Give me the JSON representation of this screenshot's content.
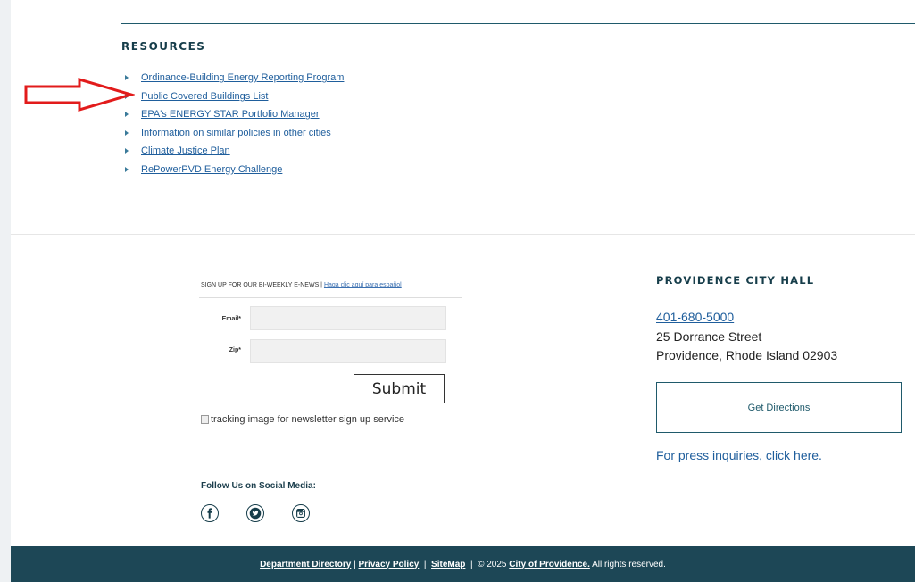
{
  "resources": {
    "title": "RESOURCES",
    "links": [
      "Ordinance-Building Energy Reporting Program",
      "Public Covered Buildings List",
      "EPA's ENERGY STAR Portfolio Manager",
      "Information on similar policies in other cities",
      "Climate Justice Plan",
      "RePowerPVD Energy Challenge"
    ]
  },
  "newsletter": {
    "heading": "SIGN UP FOR OUR BI-WEEKLY E-NEWS | ",
    "spanish_link": "Haga clic aquí para español",
    "email_label": "Email*",
    "zip_label": "Zip*",
    "submit_label": "Submit",
    "tracking_alt": "tracking image for newsletter sign up service"
  },
  "social": {
    "heading": "Follow Us on Social Media:",
    "icons": [
      "facebook-icon",
      "twitter-icon",
      "instagram-icon"
    ]
  },
  "city_hall": {
    "title": "PROVIDENCE CITY HALL",
    "phone": "401-680-5000",
    "street": "25 Dorrance Street",
    "city": "Providence, Rhode Island 02903",
    "directions_label": "Get Directions",
    "press_link": "For press inquiries, click here."
  },
  "footer": {
    "department_directory": "Department Directory",
    "sep1": " | ",
    "privacy_policy": "Privacy Policy",
    "sep2": "  |  ",
    "sitemap": "SiteMap",
    "copyright_prefix": "  |  © 2025 ",
    "city_link": "City of Providence.",
    "copyright_suffix": " All rights reserved."
  },
  "colors": {
    "accent": "#1f5a6b",
    "footer_bg": "#1d4756",
    "link": "#1f5e9c",
    "annotation_arrow": "#e21b1b"
  }
}
